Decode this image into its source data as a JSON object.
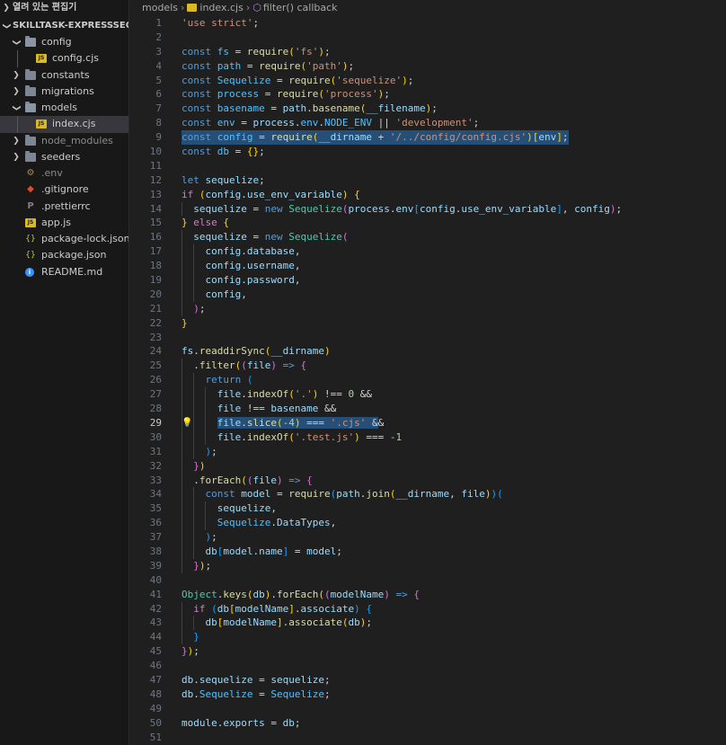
{
  "explorer": {
    "open_editors_label": "열려 있는 편집기",
    "root_label": "SKILLTASK-EXPRESSSEQUE...",
    "items": [
      {
        "label": "config",
        "type": "folder",
        "open": true,
        "depth": 0
      },
      {
        "label": "config.cjs",
        "type": "js",
        "depth": 1
      },
      {
        "label": "constants",
        "type": "folder",
        "open": false,
        "depth": 0
      },
      {
        "label": "migrations",
        "type": "folder",
        "open": false,
        "depth": 0
      },
      {
        "label": "models",
        "type": "folder",
        "open": true,
        "depth": 0
      },
      {
        "label": "index.cjs",
        "type": "js",
        "depth": 1,
        "selected": true
      },
      {
        "label": "node_modules",
        "type": "folder",
        "open": false,
        "depth": 0,
        "dim": true
      },
      {
        "label": "seeders",
        "type": "folder",
        "open": false,
        "depth": 0
      },
      {
        "label": ".env",
        "type": "env",
        "depth": 0,
        "dim": true
      },
      {
        "label": ".gitignore",
        "type": "git",
        "depth": 0
      },
      {
        "label": ".prettierrc",
        "type": "pret",
        "depth": 0
      },
      {
        "label": "app.js",
        "type": "js",
        "depth": 0
      },
      {
        "label": "package-lock.json",
        "type": "json",
        "depth": 0
      },
      {
        "label": "package.json",
        "type": "json",
        "depth": 0
      },
      {
        "label": "README.md",
        "type": "info",
        "depth": 0
      }
    ]
  },
  "breadcrumb": {
    "folder": "models",
    "file": "index.cjs",
    "symbol": "filter() callback"
  },
  "editor": {
    "language": "javascript",
    "current_line": 29,
    "lines": [
      "'use strict';",
      "",
      "const fs = require('fs');",
      "const path = require('path');",
      "const Sequelize = require('sequelize');",
      "const process = require('process');",
      "const basename = path.basename(__filename);",
      "const env = process.env.NODE_ENV || 'development';",
      "const config = require(__dirname + '/../config/config.cjs')[env];",
      "const db = {};",
      "",
      "let sequelize;",
      "if (config.use_env_variable) {",
      "  sequelize = new Sequelize(process.env[config.use_env_variable], config);",
      "} else {",
      "  sequelize = new Sequelize(",
      "    config.database,",
      "    config.username,",
      "    config.password,",
      "    config,",
      "  );",
      "}",
      "",
      "fs.readdirSync(__dirname)",
      "  .filter((file) => {",
      "    return (",
      "      file.indexOf('.') !== 0 &&",
      "      file !== basename &&",
      "      file.slice(-4) === '.cjs' &&",
      "      file.indexOf('.test.js') === -1",
      "    );",
      "  })",
      "  .forEach((file) => {",
      "    const model = require(path.join(__dirname, file))(",
      "      sequelize,",
      "      Sequelize.DataTypes,",
      "    );",
      "    db[model.name] = model;",
      "  });",
      "",
      "Object.keys(db).forEach((modelName) => {",
      "  if (db[modelName].associate) {",
      "    db[modelName].associate(db);",
      "  }",
      "});",
      "",
      "db.sequelize = sequelize;",
      "db.Sequelize = Sequelize;",
      "",
      "module.exports = db;",
      ""
    ]
  },
  "colors": {
    "background": "#1f1f1f",
    "sidebar": "#181818",
    "selection": "#264f78",
    "keyword": "#569cd6",
    "string": "#ce9178",
    "variable": "#9cdcfe",
    "function": "#dcdcaa"
  }
}
